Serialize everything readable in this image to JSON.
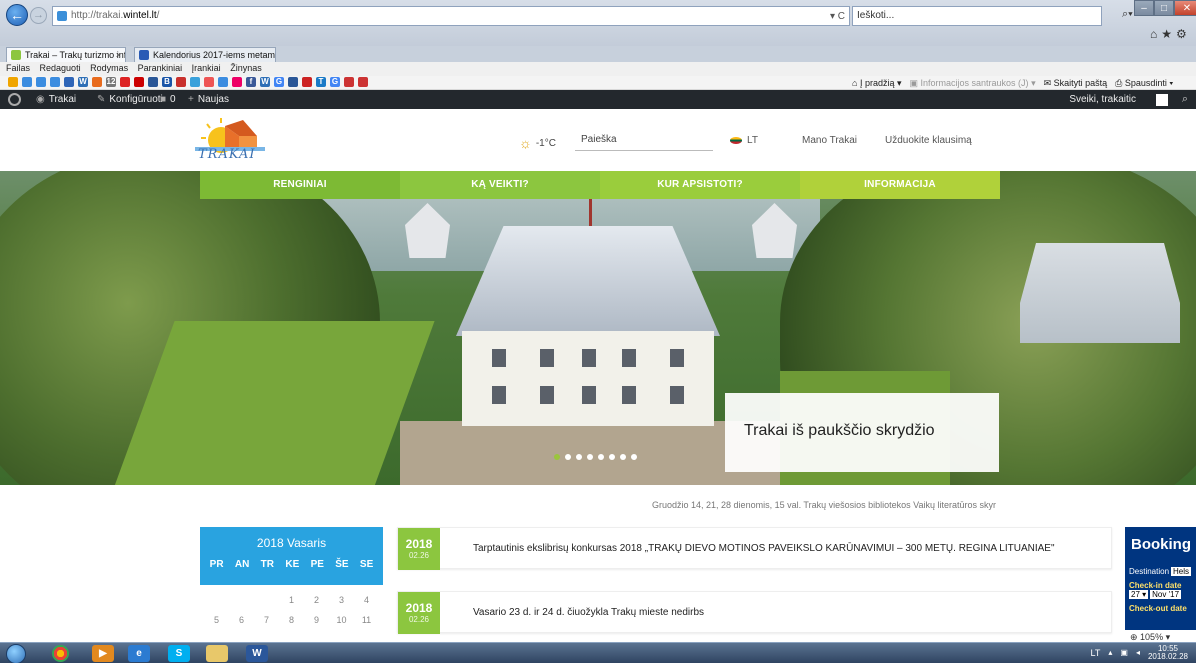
{
  "browser": {
    "url_prefix": "http://trakai.",
    "url_host": "wintel.lt",
    "url_suffix": "/",
    "addr_tools": "▾ C",
    "search_placeholder": "Ieškoti...",
    "tabs": [
      {
        "label": "Trakai – Trakų turizmo infor...",
        "active": true
      },
      {
        "label": "Kalendorius 2017-iems metam...",
        "active": false
      }
    ],
    "menu": [
      "Failas",
      "Redaguoti",
      "Rodymas",
      "Parankiniai",
      "Įrankiai",
      "Žinynas"
    ],
    "command_bar": {
      "home": "Į pradžią",
      "feeds": "Informacijos santraukos (J)",
      "mail": "Skaityti paštą",
      "print": "Spausdinti"
    },
    "zoom": "105%"
  },
  "wp_admin_bar": {
    "site": "Trakai",
    "customize": "Konfigūruoti",
    "comments": "0",
    "new": "Naujas",
    "greeting": "Sveiki, trakaitic"
  },
  "header": {
    "logo_text": "TRAKAI",
    "weather": "-1°C",
    "search_placeholder": "Paieška",
    "language": "LT",
    "links": [
      "Mano Trakai",
      "Užduokite klausimą"
    ]
  },
  "nav": {
    "items": [
      {
        "label": "RENGINIAI",
        "color": "#7dba34"
      },
      {
        "label": "KĄ VEIKTI?",
        "color": "#8cc63f"
      },
      {
        "label": "KUR APSISTOTI?",
        "color": "#9acd3c"
      },
      {
        "label": "INFORMACIJA",
        "color": "#b0d13a"
      }
    ]
  },
  "hero": {
    "caption": "Trakai iš paukščio skrydžio",
    "slide_count": 8,
    "active_slide": 1
  },
  "ticker": "Gruodžio 14, 21, 28 dienomis, 15 val. Trakų viešosios bibliotekos Vaikų literatūros skyr",
  "calendar": {
    "title": "2018 Vasaris",
    "weekdays": [
      "PR",
      "AN",
      "TR",
      "KE",
      "PE",
      "ŠE",
      "SE"
    ],
    "rows": [
      [
        "",
        "",
        "",
        "1",
        "2",
        "3",
        "4"
      ],
      [
        "5",
        "6",
        "7",
        "8",
        "9",
        "10",
        "11"
      ]
    ],
    "accent": "#29a3e0"
  },
  "events": [
    {
      "year": "2018",
      "date": "02.26",
      "title": "Tarptautinis ekslibrisų konkursas 2018 „TRAKŲ DIEVO MOTINOS PAVEIKSLO KARŪNAVIMUI – 300 METŲ. REGINA LITUANIAE\""
    },
    {
      "year": "2018",
      "date": "02.26",
      "title": "Vasario 23 d. ir 24 d. čiuožykla Trakų mieste nedirbs"
    }
  ],
  "booking": {
    "brand": "Booking",
    "destination_label": "Destination",
    "destination_value": "Hels",
    "checkin_label": "Check-in date",
    "checkin_day": "27 ▾",
    "checkin_month": "Nov '17",
    "checkout_label": "Check-out date"
  },
  "taskbar": {
    "language": "LT",
    "time": "10:55",
    "date": "2018.02.28"
  }
}
